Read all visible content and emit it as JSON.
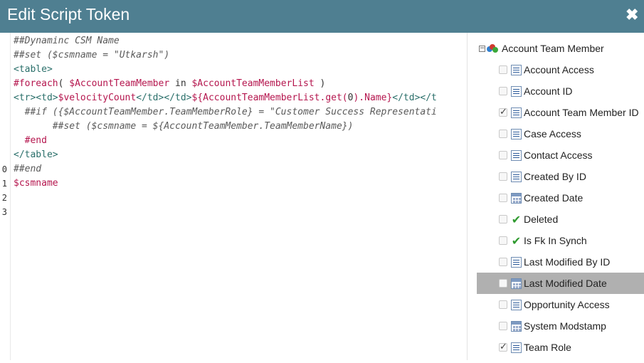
{
  "dialog": {
    "title": "Edit Script Token",
    "close_icon": "close-icon"
  },
  "editor": {
    "line_numbers": [
      "0",
      "1",
      "2",
      "3"
    ],
    "lines": [
      [
        {
          "t": "##Dynaminc CSM Name",
          "c": "cm"
        }
      ],
      [
        {
          "t": "##set ($csmname = \"Utkarsh\")",
          "c": "cm"
        }
      ],
      [
        {
          "t": "<table>",
          "c": "tag"
        }
      ],
      [
        {
          "t": "#foreach",
          "c": "kw"
        },
        {
          "t": "( ",
          "c": "plain"
        },
        {
          "t": "$AccountTeamMember",
          "c": "var"
        },
        {
          "t": " in ",
          "c": "plain"
        },
        {
          "t": "$AccountTeamMemberList",
          "c": "var"
        },
        {
          "t": " )",
          "c": "plain"
        }
      ],
      [
        {
          "t": "<tr><td>",
          "c": "tag"
        },
        {
          "t": "$velocityCount",
          "c": "var"
        },
        {
          "t": "</td></td>",
          "c": "tag"
        },
        {
          "t": "${AccountTeamMemberList.get(",
          "c": "var"
        },
        {
          "t": "0",
          "c": "plain"
        },
        {
          "t": ").Name}",
          "c": "var"
        },
        {
          "t": "</td></t",
          "c": "tag"
        }
      ],
      [
        {
          "t": "  ##if ({$AccountTeamMember.TeamMemberRole} = \"Customer Success Representati",
          "c": "cm"
        }
      ],
      [
        {
          "t": "       ##set ($csmname = ${AccountTeamMember.TeamMemberName})",
          "c": "cm"
        }
      ],
      [
        {
          "t": "  #end",
          "c": "kw"
        }
      ],
      [
        {
          "t": "</table>",
          "c": "tag"
        }
      ],
      [
        {
          "t": "##end",
          "c": "cm"
        }
      ],
      [
        {
          "t": "$csmname",
          "c": "var"
        }
      ]
    ]
  },
  "tree": {
    "root_label": "Account Team Member",
    "fields": [
      {
        "label": "Account Access",
        "type": "text",
        "checked": false,
        "highlight": false
      },
      {
        "label": "Account ID",
        "type": "text",
        "checked": false,
        "highlight": false
      },
      {
        "label": "Account Team Member ID",
        "type": "text",
        "checked": true,
        "highlight": false
      },
      {
        "label": "Case Access",
        "type": "text",
        "checked": false,
        "highlight": false
      },
      {
        "label": "Contact Access",
        "type": "text",
        "checked": false,
        "highlight": false
      },
      {
        "label": "Created By ID",
        "type": "text",
        "checked": false,
        "highlight": false
      },
      {
        "label": "Created Date",
        "type": "date",
        "checked": false,
        "highlight": false
      },
      {
        "label": "Deleted",
        "type": "bool",
        "checked": false,
        "highlight": false
      },
      {
        "label": "Is Fk In Synch",
        "type": "bool",
        "checked": false,
        "highlight": false
      },
      {
        "label": "Last Modified By ID",
        "type": "text",
        "checked": false,
        "highlight": false
      },
      {
        "label": "Last Modified Date",
        "type": "date",
        "checked": false,
        "highlight": true
      },
      {
        "label": "Opportunity Access",
        "type": "text",
        "checked": false,
        "highlight": false
      },
      {
        "label": "System Modstamp",
        "type": "date",
        "checked": false,
        "highlight": false
      },
      {
        "label": "Team Role",
        "type": "text",
        "checked": true,
        "highlight": false
      }
    ]
  },
  "colors": {
    "titlebar": "#4f7f91",
    "keyword": "#b5164e",
    "tag": "#2a6f6a",
    "highlight_row": "#b0b0b0"
  }
}
